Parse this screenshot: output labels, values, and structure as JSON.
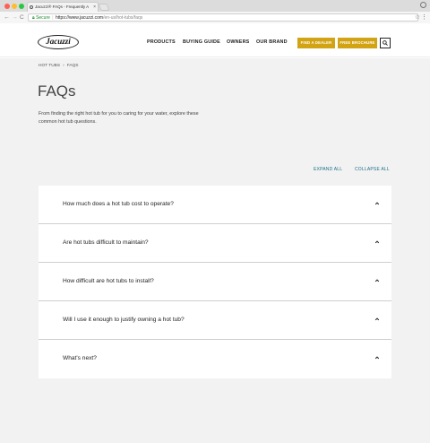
{
  "browser": {
    "tab_title": "Jacuzzi® FAQs - Frequently A",
    "tab_close": "×",
    "back": "←",
    "forward": "→",
    "reload": "C",
    "secure_label": "Secure",
    "url_main": "https://www.jacuzzi.com",
    "url_rest": "/en-us/hot-tubs/faqs",
    "star": "☆",
    "menu": "⋮"
  },
  "header": {
    "logo_text": "Jacuzzi",
    "nav": [
      "PRODUCTS",
      "BUYING GUIDE",
      "OWNERS",
      "OUR BRAND"
    ],
    "cta_dealer": "FIND A DEALER",
    "cta_brochure": "FREE BROCHURE"
  },
  "breadcrumb": {
    "items": [
      "HOT TUBS",
      "FAQS"
    ],
    "separator": "›"
  },
  "page": {
    "title": "FAQs",
    "intro": "From finding the right hot tub for you to caring for your water, explore these common hot tub questions."
  },
  "controls": {
    "expand_all": "EXPAND ALL",
    "collapse_all": "COLLAPSE ALL"
  },
  "faqs": [
    "How much does a hot tub cost to operate?",
    "Are hot tubs difficult to maintain?",
    "How difficult are hot tubs to install?",
    "Will I use it enough to justify owning a hot tub?",
    "What's next?"
  ],
  "colors": {
    "accent": "#d2a313",
    "link": "#1d6f8a",
    "background": "#f2f2f2"
  }
}
